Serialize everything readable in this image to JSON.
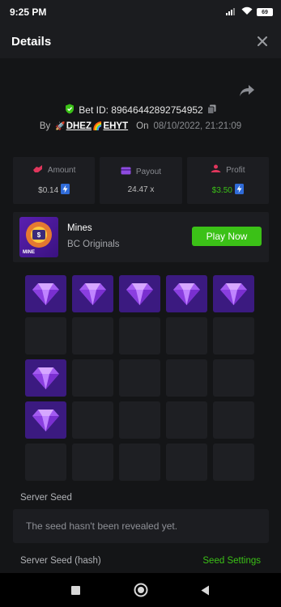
{
  "status_bar": {
    "time": "9:25 PM",
    "battery": "69",
    "icons": [
      "signal-icon",
      "wifi-icon",
      "battery-icon"
    ]
  },
  "header": {
    "title": "Details",
    "close_icon": "close-icon"
  },
  "bet": {
    "bet_id_label": "Bet ID: 89646442892754952",
    "by_label": "By",
    "player_name": "DHEZ",
    "player_name_2": "EHYT",
    "on_label": "On",
    "date": "08/10/2022, 21:21:09"
  },
  "stats": [
    {
      "label": "Amount",
      "value": "$0.14",
      "icon": "amount-icon"
    },
    {
      "label": "Payout",
      "value": "24.47 x",
      "icon": "payout-icon"
    },
    {
      "label": "Profit",
      "value": "$3.50",
      "icon": "profit-icon"
    }
  ],
  "game": {
    "name": "Mines",
    "provider": "BC Originals",
    "thumb_text": "MINE",
    "play_button": "Play Now"
  },
  "mines_grid": {
    "rows": 5,
    "cols": 5,
    "cells": [
      "gem",
      "gem",
      "gem",
      "gem",
      "gem",
      "empty",
      "empty",
      "empty",
      "empty",
      "empty",
      "gem",
      "empty",
      "empty",
      "empty",
      "empty",
      "gem",
      "empty",
      "empty",
      "empty",
      "empty",
      "empty",
      "empty",
      "empty",
      "empty",
      "empty"
    ]
  },
  "seed": {
    "server_seed_label": "Server Seed",
    "seed_placeholder": "The seed hasn't been revealed yet.",
    "hash_label": "Server Seed (hash)",
    "settings_link": "Seed Settings"
  },
  "colors": {
    "accent_green": "#3bc117",
    "gem_purple": "#3b1a80",
    "tile": "#1e1f23",
    "panel": "#1c1d21",
    "background": "#141517"
  }
}
